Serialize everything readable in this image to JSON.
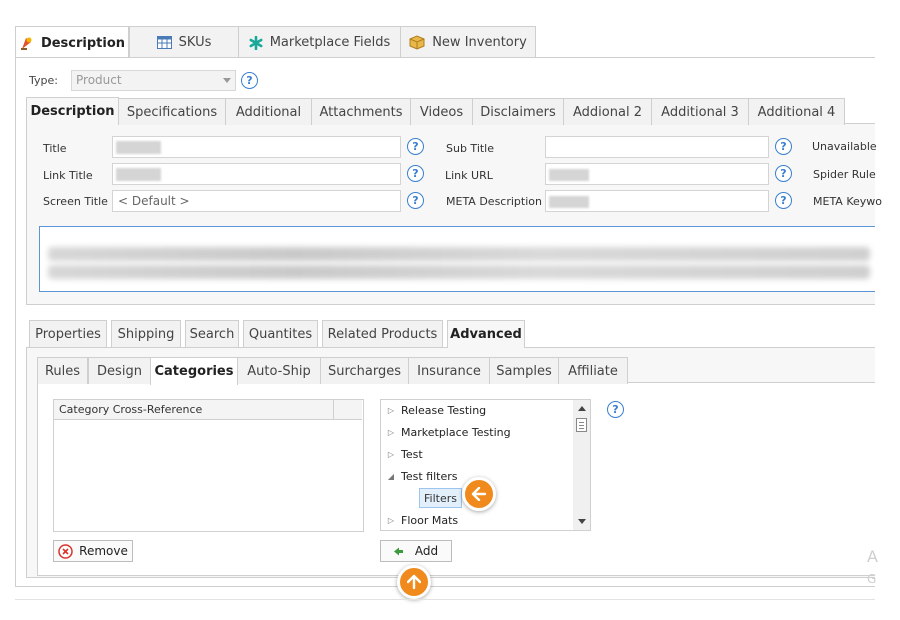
{
  "top_tabs": [
    {
      "label": "Description",
      "icon": "description-icon",
      "active": true
    },
    {
      "label": "SKUs",
      "icon": "grid-icon",
      "active": false
    },
    {
      "label": "Marketplace Fields",
      "icon": "asterisk-icon",
      "active": false
    },
    {
      "label": "New Inventory",
      "icon": "box-icon",
      "active": false
    }
  ],
  "type_row": {
    "label": "Type:",
    "value": "Product"
  },
  "description_tabs": [
    {
      "label": "Description",
      "active": true
    },
    {
      "label": "Specifications"
    },
    {
      "label": "Additional"
    },
    {
      "label": "Attachments"
    },
    {
      "label": "Videos"
    },
    {
      "label": "Disclaimers"
    },
    {
      "label": "Addional 2"
    },
    {
      "label": "Additional 3"
    },
    {
      "label": "Additional 4"
    }
  ],
  "fields": {
    "title": "Title",
    "link_title": "Link Title",
    "screen_title": "Screen Title",
    "screen_title_value": "< Default >",
    "sub_title": "Sub Title",
    "link_url": "Link URL",
    "meta_description": "META Description",
    "unavailable": "Unavailable",
    "spider_rule": "Spider Rule",
    "meta_keywords": "META Keywo"
  },
  "help_glyph": "?",
  "lower_tabs": [
    {
      "label": "Properties"
    },
    {
      "label": "Shipping"
    },
    {
      "label": "Search"
    },
    {
      "label": "Quantites"
    },
    {
      "label": "Related Products"
    },
    {
      "label": "Advanced",
      "active": true
    }
  ],
  "advanced_tabs": [
    {
      "label": "Rules"
    },
    {
      "label": "Design"
    },
    {
      "label": "Categories",
      "active": true
    },
    {
      "label": "Auto-Ship"
    },
    {
      "label": "Surcharges"
    },
    {
      "label": "Insurance"
    },
    {
      "label": "Samples"
    },
    {
      "label": "Affiliate"
    }
  ],
  "category_list": {
    "header": "Category Cross-Reference"
  },
  "tree": {
    "items": [
      {
        "label": "Release Testing",
        "arrow": "▷"
      },
      {
        "label": "Marketplace Testing",
        "arrow": "▷"
      },
      {
        "label": "Test",
        "arrow": "▷"
      },
      {
        "label": "Test filters",
        "arrow": "◢"
      },
      {
        "label": "Floor Mats",
        "arrow": "▷"
      }
    ],
    "selected_child": "Filters"
  },
  "buttons": {
    "remove": "Remove",
    "add": "Add"
  },
  "colors": {
    "accent_blue": "#3a7fd0",
    "callout_orange": "#f08a1c",
    "remove_red": "#d9342b",
    "add_green": "#3c9a3c"
  },
  "edge_fragments": {
    "a": "A",
    "g": "G"
  }
}
